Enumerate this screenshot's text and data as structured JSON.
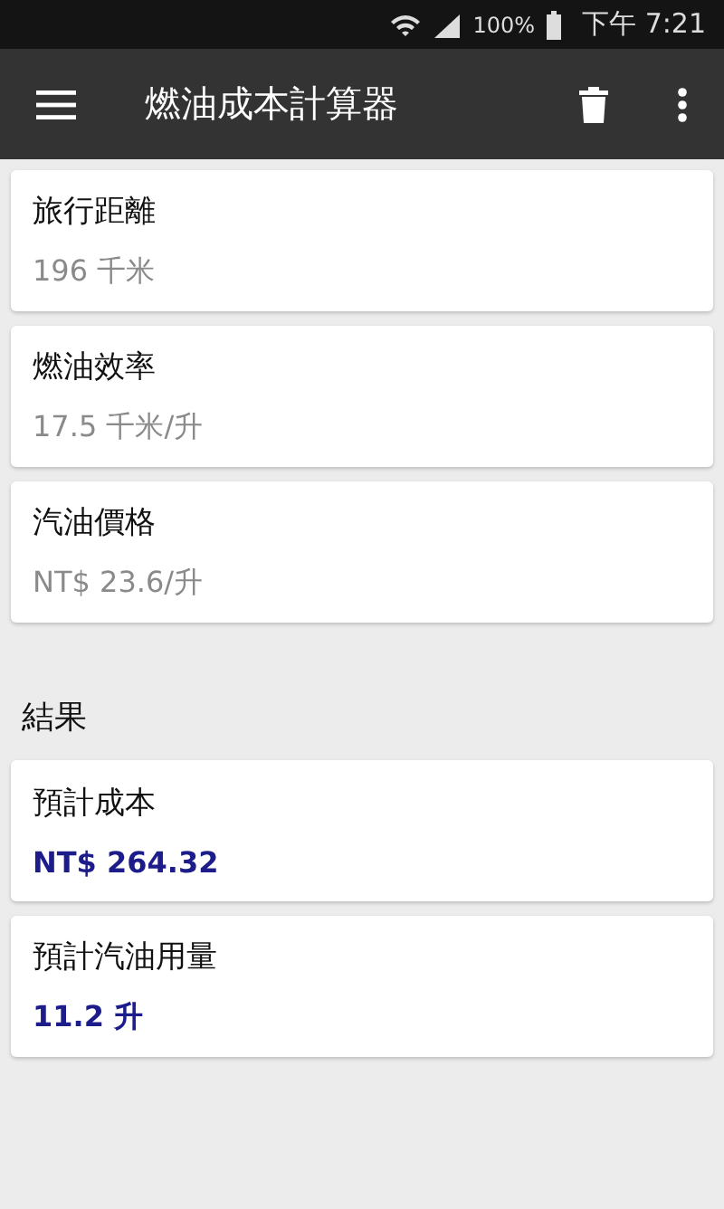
{
  "status_bar": {
    "battery_text": "100%",
    "time": "下午 7:21"
  },
  "toolbar": {
    "title": "燃油成本計算器"
  },
  "inputs": [
    {
      "label": "旅行距離",
      "value": "196 千米"
    },
    {
      "label": "燃油效率",
      "value": "17.5 千米/升"
    },
    {
      "label": "汽油價格",
      "value": "NT$ 23.6/升"
    }
  ],
  "results": {
    "heading": "結果",
    "items": [
      {
        "label": "預計成本",
        "value": "NT$ 264.32"
      },
      {
        "label": "預計汽油用量",
        "value": "11.2 升"
      }
    ]
  }
}
